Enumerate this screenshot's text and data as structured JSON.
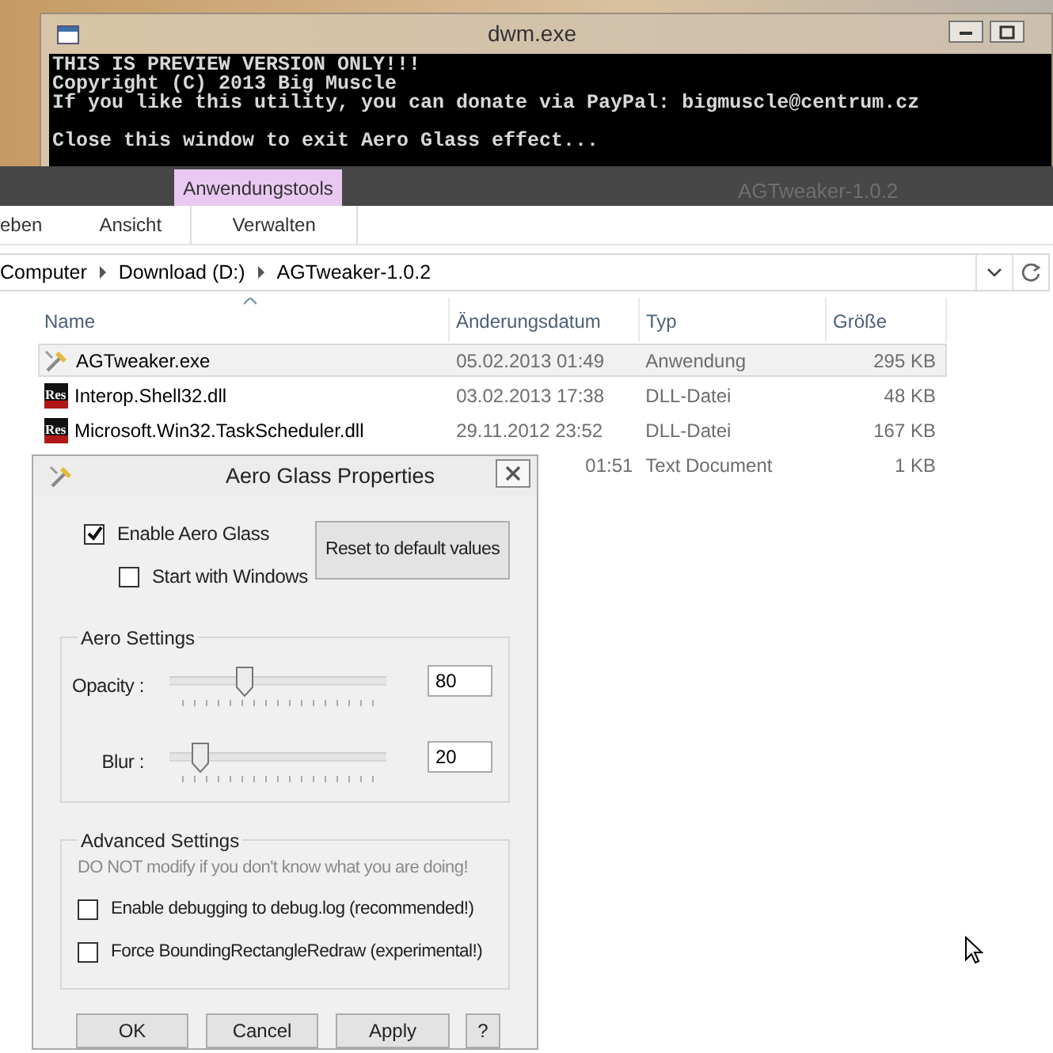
{
  "console_window": {
    "title": "dwm.exe",
    "lines": [
      {
        "text": "THIS IS PREVIEW VERSION ONLY!!!",
        "blank_line_before": false
      },
      {
        "text": "Copyright (C) 2013 Big Muscle",
        "blank_line_before": false
      },
      {
        "text": "If you like this utility, you can donate via PayPal: bigmuscle@centrum.cz",
        "blank_line_before": false
      },
      {
        "text": "Close this window to exit Aero Glass effect...",
        "blank_line_before": true
      }
    ]
  },
  "explorer": {
    "title": "AGTweaker-1.0.2",
    "context_tab": "Anwendungstools",
    "ribbon_tabs": [
      {
        "label": "eben",
        "contextual": false
      },
      {
        "label": "Ansicht",
        "contextual": false
      },
      {
        "label": "Verwalten",
        "contextual": true
      }
    ],
    "breadcrumb": [
      "Computer",
      "Download (D:)",
      "AGTweaker-1.0.2"
    ],
    "columns": [
      {
        "label": "Name",
        "sorted": true
      },
      {
        "label": "Änderungsdatum",
        "sorted": false
      },
      {
        "label": "Typ",
        "sorted": false
      },
      {
        "label": "Größe",
        "sorted": false
      }
    ],
    "rows": [
      {
        "kind": "application",
        "name": "AGTweaker.exe",
        "date": "05.02.2013 01:49",
        "type": "Anwendung",
        "size": "295 KB",
        "selected": true
      },
      {
        "kind": "library",
        "icon_label": "Res",
        "name": "Interop.Shell32.dll",
        "date": "03.02.2013 17:38",
        "type": "DLL-Datei",
        "size": "48 KB",
        "selected": false
      },
      {
        "kind": "library",
        "icon_label": "Res",
        "name": "Microsoft.Win32.TaskScheduler.dll",
        "date": "29.11.2012 23:52",
        "type": "DLL-Datei",
        "size": "167 KB",
        "selected": false
      },
      {
        "kind": "hidden",
        "date": "01:51",
        "type": "Text Document",
        "size": "1 KB",
        "selected": false
      }
    ]
  },
  "dialog": {
    "title": "Aero Glass Properties",
    "options": [
      {
        "label": "Enable Aero Glass",
        "checked": true
      },
      {
        "label": "Start with Windows",
        "checked": false
      }
    ],
    "reset_button": "Reset to default values",
    "aero_settings": {
      "title": "Aero Settings",
      "sliders": [
        {
          "label": "Opacity :",
          "level": 0.33,
          "value": "80"
        },
        {
          "label": "Blur :",
          "level": 0.11,
          "value": "20"
        }
      ]
    },
    "advanced_settings": {
      "title": "Advanced Settings",
      "warning": "DO NOT modify if you don't know what you are doing!",
      "options": [
        {
          "label": "Enable debugging to debug.log (recommended!)",
          "checked": false
        },
        {
          "label": "Force BoundingRectangleRedraw (experimental!)",
          "checked": false
        }
      ]
    },
    "buttons": [
      "OK",
      "Cancel",
      "Apply",
      "?"
    ]
  }
}
